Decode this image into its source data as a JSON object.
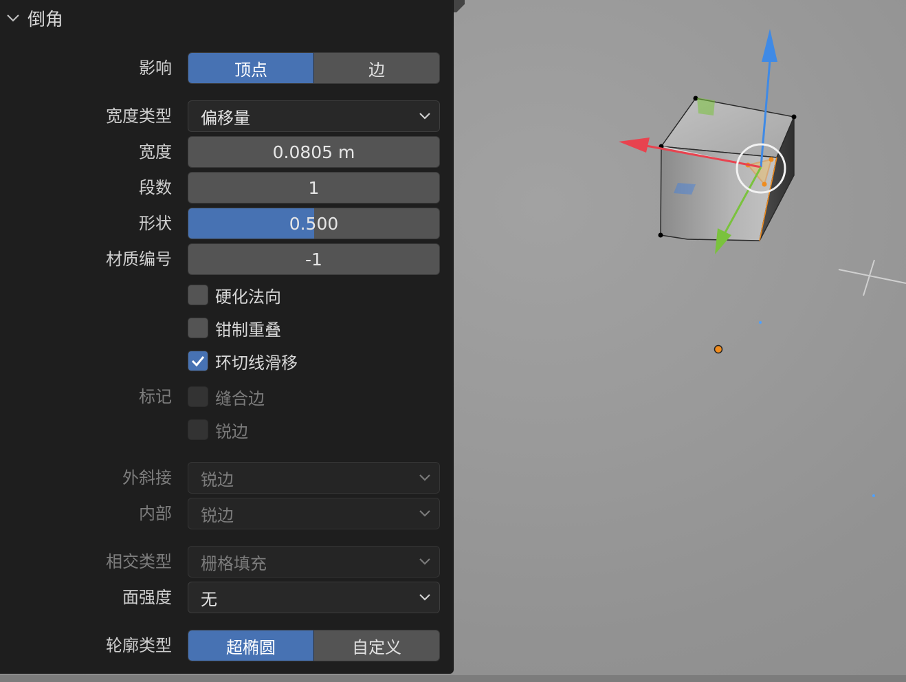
{
  "panel": {
    "title": "倒角",
    "affect": {
      "label": "影响",
      "options": [
        "顶点",
        "边"
      ],
      "selected": "顶点"
    },
    "width_type": {
      "label": "宽度类型",
      "value": "偏移量"
    },
    "width": {
      "label": "宽度",
      "value": "0.0805 m"
    },
    "segments": {
      "label": "段数",
      "value": "1"
    },
    "shape": {
      "label": "形状",
      "value": "0.500",
      "fraction": 0.5
    },
    "material_index": {
      "label": "材质编号",
      "value": "-1"
    },
    "harden_normals": {
      "label": "硬化法向",
      "checked": false
    },
    "clamp_overlap": {
      "label": "钳制重叠",
      "checked": false
    },
    "loop_slide": {
      "label": "环切线滑移",
      "checked": true
    },
    "mark": {
      "label": "标记",
      "seam": "缝合边",
      "sharp": "锐边"
    },
    "miter_outer": {
      "label": "外斜接",
      "value": "锐边"
    },
    "miter_inner": {
      "label": "内部",
      "value": "锐边"
    },
    "intersection_type": {
      "label": "相交类型",
      "value": "栅格填充"
    },
    "face_strength": {
      "label": "面强度",
      "value": "无"
    },
    "profile_type": {
      "label": "轮廓类型",
      "options": [
        "超椭圆",
        "自定义"
      ],
      "selected": "超椭圆"
    }
  },
  "colors": {
    "accent": "#4772b3",
    "panel_bg": "#1e1e1e",
    "gizmo_x": "#e8434f",
    "gizmo_y": "#7ac23d",
    "gizmo_z": "#3f8ae6",
    "selection": "#f08c1e"
  }
}
